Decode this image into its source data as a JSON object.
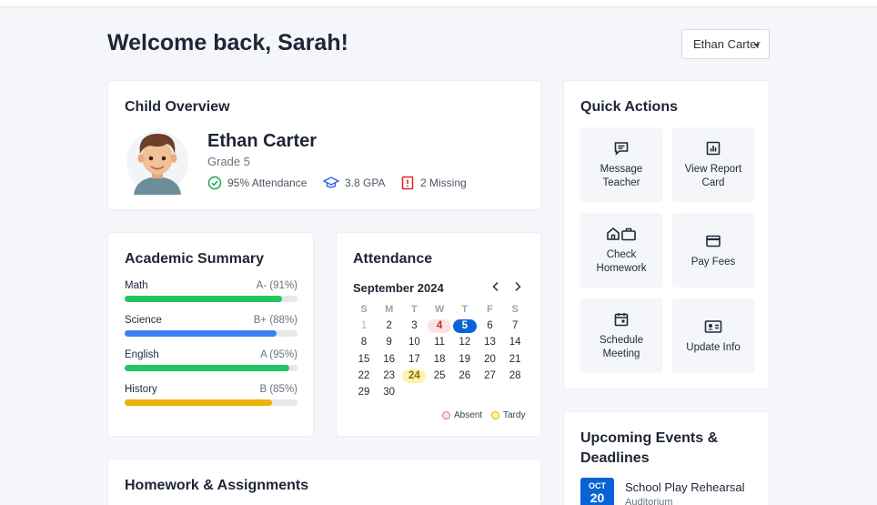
{
  "header": {
    "welcome": "Welcome back, Sarah!",
    "child_select_value": "Ethan Carter"
  },
  "overview": {
    "title": "Child Overview",
    "child_name": "Ethan Carter",
    "grade": "Grade 5",
    "stats": {
      "attendance": "95% Attendance",
      "gpa": "3.8 GPA",
      "missing": "2 Missing"
    }
  },
  "academic": {
    "title": "Academic Summary",
    "subjects": [
      {
        "name": "Math",
        "grade": "A- (91%)",
        "percent": 91,
        "color": "#22c55e"
      },
      {
        "name": "Science",
        "grade": "B+ (88%)",
        "percent": 88,
        "color": "#3b82f6"
      },
      {
        "name": "English",
        "grade": "A (95%)",
        "percent": 95,
        "color": "#22c55e"
      },
      {
        "name": "History",
        "grade": "B (85%)",
        "percent": 85,
        "color": "#eab308"
      }
    ]
  },
  "attendance": {
    "title": "Attendance",
    "month": "September 2024",
    "weekdays": [
      "S",
      "M",
      "T",
      "W",
      "T",
      "F",
      "S"
    ],
    "weeks": [
      [
        "1",
        "2",
        "3",
        "4",
        "5",
        "6",
        "7"
      ],
      [
        "8",
        "9",
        "10",
        "11",
        "12",
        "13",
        "14"
      ],
      [
        "15",
        "16",
        "17",
        "18",
        "19",
        "20",
        "21"
      ],
      [
        "22",
        "23",
        "24",
        "25",
        "26",
        "27",
        "28"
      ],
      [
        "29",
        "30",
        "",
        "",
        "",
        "",
        ""
      ]
    ],
    "absent_days": [
      "4"
    ],
    "tardy_days": [
      "24"
    ],
    "selected_day": "5",
    "legend": {
      "absent": "Absent",
      "tardy": "Tardy"
    }
  },
  "homework": {
    "title": "Homework & Assignments"
  },
  "quick_actions": {
    "title": "Quick Actions",
    "items": [
      {
        "label": "Message Teacher",
        "icon": "message-icon"
      },
      {
        "label": "View Report Card",
        "icon": "chart-icon"
      },
      {
        "label": "Check Homework",
        "icon": "home-briefcase-icon"
      },
      {
        "label": "Pay Fees",
        "icon": "credit-card-icon"
      },
      {
        "label": "Schedule Meeting",
        "icon": "calendar-icon"
      },
      {
        "label": "Update Info",
        "icon": "id-card-icon"
      }
    ]
  },
  "events": {
    "title": "Upcoming Events & Deadlines",
    "items": [
      {
        "month": "OCT",
        "day": "20",
        "title": "School Play Rehearsal",
        "location": "Auditorium"
      }
    ]
  },
  "colors": {
    "primary": "#0a63d6",
    "absent": "#fde2e2",
    "tardy": "#fdf2b0"
  }
}
